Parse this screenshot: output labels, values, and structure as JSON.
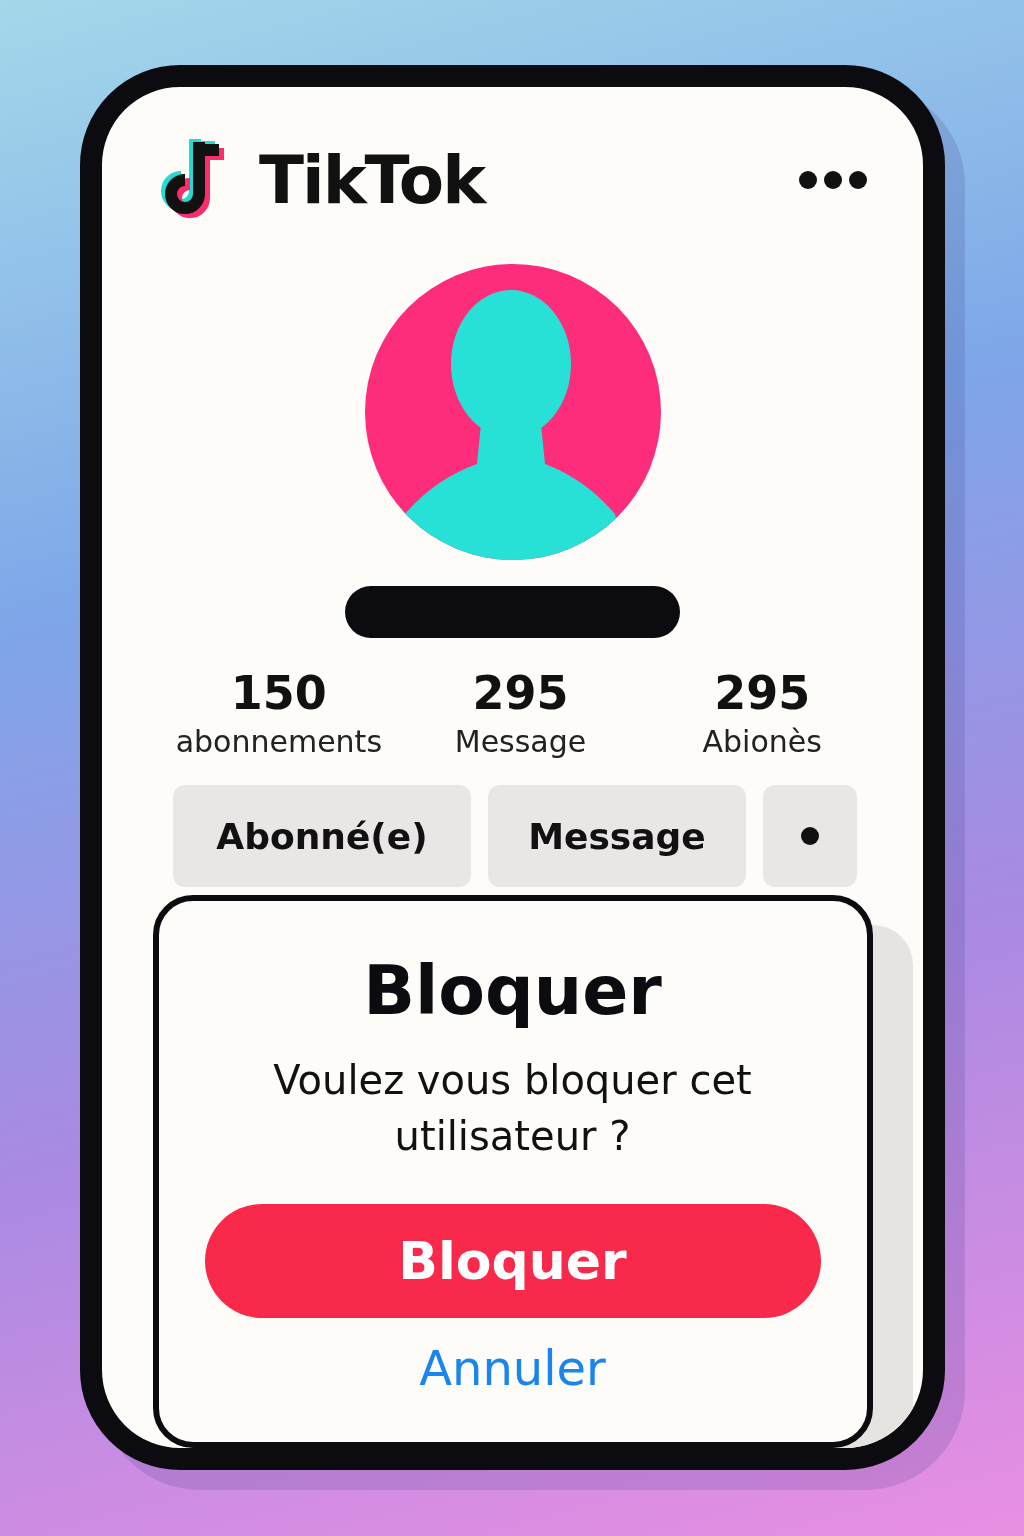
{
  "app": {
    "name": "TikTok"
  },
  "profile": {
    "stats": [
      {
        "value": "150",
        "label": "abonnements"
      },
      {
        "value": "295",
        "label": "Message"
      },
      {
        "value": "295",
        "label": "Abionès"
      }
    ]
  },
  "actions": [
    {
      "kind": "text",
      "label": "Abonné(e)"
    },
    {
      "kind": "text",
      "label": "Message"
    },
    {
      "kind": "more"
    }
  ],
  "dialog": {
    "title": "Bloquer",
    "message": "Voulez vous bloquer cet utilisateur ?",
    "confirm": "Bloquer",
    "cancel": "Annuler"
  }
}
